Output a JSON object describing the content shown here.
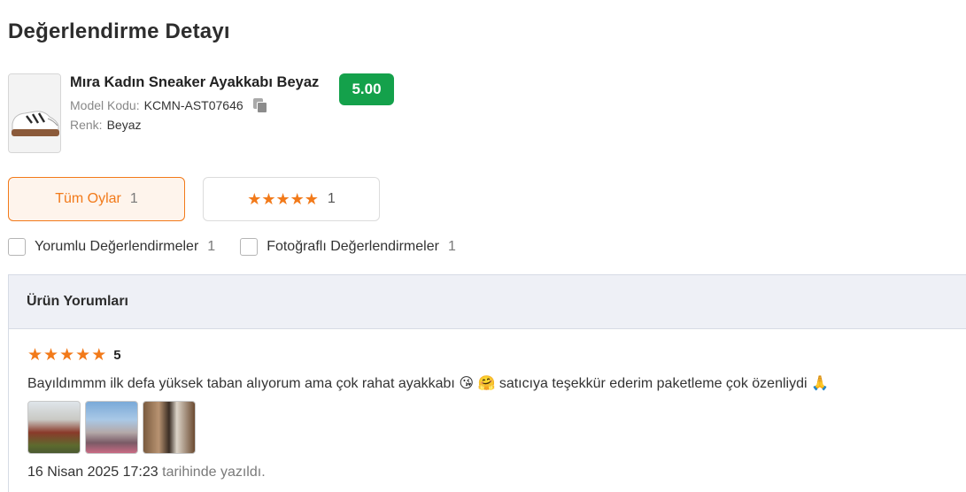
{
  "page": {
    "title": "Değerlendirme Detayı"
  },
  "product": {
    "name": "Mıra Kadın Sneaker Ayakkabı Beyaz",
    "model_label": "Model Kodu:",
    "model_value": "KCMN-AST07646",
    "color_label": "Renk:",
    "color_value": "Beyaz",
    "score": "5.00",
    "score_color": "#14a14b"
  },
  "filters": {
    "all_label": "Tüm Oylar",
    "all_count": "1",
    "five_star_count": "1",
    "accent_color": "#f27a1a"
  },
  "checkboxes": [
    {
      "label": "Yorumlu Değerlendirmeler",
      "count": "1",
      "checked": false
    },
    {
      "label": "Fotoğraflı Değerlendirmeler",
      "count": "1",
      "checked": false
    }
  ],
  "reviews_section": {
    "title": "Ürün Yorumları",
    "review": {
      "rating": "5",
      "text": "Bayıldımmm ilk defa yüksek taban alıyorum ama çok rahat ayakkabı 😘 🤗 satıcıya teşekkür ederim paketleme çok özenliydi 🙏",
      "photo_count": 3,
      "date": "16 Nisan 2025 17:23",
      "date_suffix": "tarihinde yazıldı."
    }
  },
  "icons": {
    "copy": "copy-icon",
    "star": "star-icon",
    "checkbox": "checkbox-icon"
  }
}
